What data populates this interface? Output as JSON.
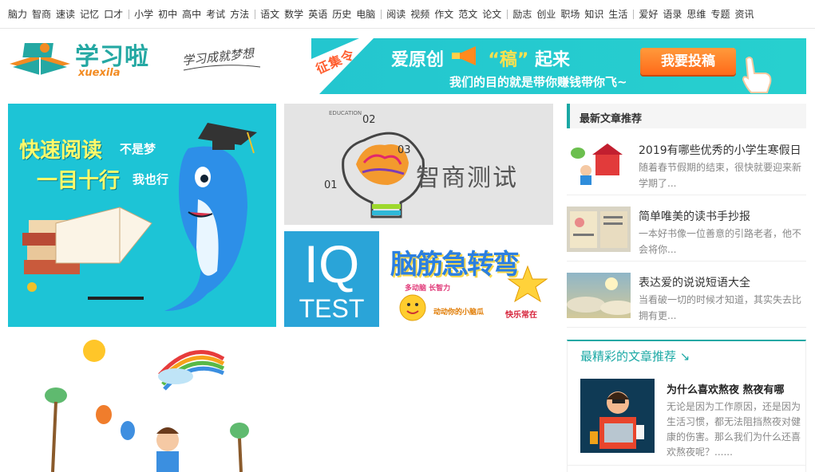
{
  "topnav": [
    [
      "脑力",
      "智商",
      "速读",
      "记忆",
      "口才"
    ],
    [
      "小学",
      "初中",
      "高中",
      "考试",
      "方法"
    ],
    [
      "语文",
      "数学",
      "英语",
      "历史",
      "电脑"
    ],
    [
      "阅读",
      "视频",
      "作文",
      "范文",
      "论文"
    ],
    [
      "励志",
      "创业",
      "职场",
      "知识",
      "生活"
    ],
    [
      "爱好",
      "语录",
      "思维",
      "专题",
      "资讯"
    ]
  ],
  "logo": {
    "brand": "学习啦",
    "sub": "xuexila",
    "slogan": "学习成就梦想"
  },
  "banner": {
    "tag": "征集令",
    "head1a": "爱原创",
    "head1b": "“稿”",
    "head1c": "起来",
    "head2": "我们的目的就是带你赚钱带你飞~",
    "button": "我要投稿"
  },
  "tiles": {
    "read": {
      "l1": "快速阅读",
      "l1b": "不是梦",
      "l2": "一目十行",
      "l2b": "我也行"
    },
    "iq": {
      "title": "智商测试",
      "edu1": "EDUCATION",
      "n1": "01",
      "n2": "02",
      "n3": "03"
    },
    "iqtest": {
      "a": "IQ",
      "b": "TEST"
    },
    "brain": {
      "title": "脑筋急转弯",
      "s": "多动脑 长智力",
      "q": "动动你的小脑瓜",
      "h": "快乐常在"
    }
  },
  "latest": {
    "heading": "最新文章推荐",
    "items": [
      {
        "title": "2019有哪些优秀的小学生寒假日",
        "desc": "随着春节假期的结束，很快就要迎来新学期了..."
      },
      {
        "title": "简单唯美的读书手抄报",
        "desc": "一本好书像一位善意的引路老者，他不会将你..."
      },
      {
        "title": "表达爱的说说短语大全",
        "desc": "当看破一切的时候才知道，其实失去比拥有更..."
      }
    ]
  },
  "best": {
    "heading": "最精彩的文章推荐 ↘",
    "title": "为什么喜欢熬夜 熬夜有哪",
    "desc": "无论是因为工作原因，还是因为生活习惯，都无法阻挡熬夜对健康的伤害。那么我们为什么还喜欢熬夜呢？......"
  }
}
